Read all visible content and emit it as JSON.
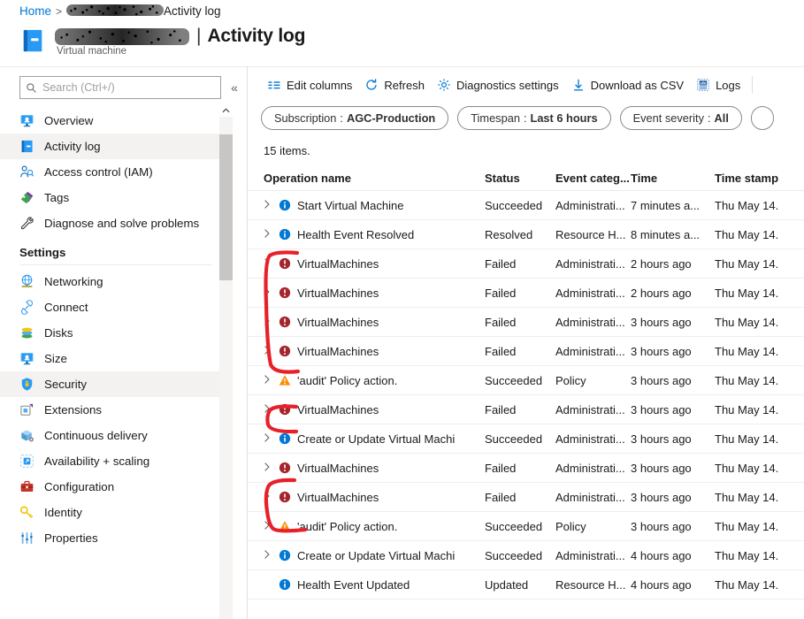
{
  "breadcrumb": {
    "home": "Home",
    "separator": ">",
    "redacted_resource": "",
    "current": "Activity log"
  },
  "header": {
    "redacted_resource_name": "",
    "divider": "|",
    "title": "Activity log",
    "subtitle": "Virtual machine",
    "icon": "virtual-machine-icon"
  },
  "sidebar": {
    "search": {
      "placeholder": "Search (Ctrl+/)",
      "value": "",
      "icon": "search-icon"
    },
    "collapse_label": "«",
    "items": [
      {
        "label": "Overview",
        "icon": "overview-icon",
        "selected": false
      },
      {
        "label": "Activity log",
        "icon": "activity-log-icon",
        "selected": true
      },
      {
        "label": "Access control (IAM)",
        "icon": "access-control-icon",
        "selected": false
      },
      {
        "label": "Tags",
        "icon": "tags-icon",
        "selected": false
      },
      {
        "label": "Diagnose and solve problems",
        "icon": "diagnose-icon",
        "selected": false
      }
    ],
    "settings_header": "Settings",
    "settings_items": [
      {
        "label": "Networking",
        "icon": "networking-icon",
        "selected": false
      },
      {
        "label": "Connect",
        "icon": "connect-icon",
        "selected": false
      },
      {
        "label": "Disks",
        "icon": "disks-icon",
        "selected": false
      },
      {
        "label": "Size",
        "icon": "size-icon",
        "selected": false
      },
      {
        "label": "Security",
        "icon": "security-icon",
        "selected": true
      },
      {
        "label": "Extensions",
        "icon": "extensions-icon",
        "selected": false
      },
      {
        "label": "Continuous delivery",
        "icon": "continuous-delivery-icon",
        "selected": false
      },
      {
        "label": "Availability + scaling",
        "icon": "availability-scaling-icon",
        "selected": false
      },
      {
        "label": "Configuration",
        "icon": "configuration-icon",
        "selected": false
      },
      {
        "label": "Identity",
        "icon": "identity-icon",
        "selected": false
      },
      {
        "label": "Properties",
        "icon": "properties-icon",
        "selected": false
      }
    ]
  },
  "toolbar": {
    "commands": [
      {
        "label": "Edit columns",
        "icon": "edit-columns-icon"
      },
      {
        "label": "Refresh",
        "icon": "refresh-icon"
      },
      {
        "label": "Diagnostics settings",
        "icon": "gear-icon"
      },
      {
        "label": "Download as CSV",
        "icon": "download-icon"
      },
      {
        "label": "Logs",
        "icon": "logs-icon"
      }
    ]
  },
  "filters": [
    {
      "name": "Subscription",
      "separator": ":",
      "value": "AGC-Production"
    },
    {
      "name": "Timespan",
      "separator": ":",
      "value": "Last 6 hours"
    },
    {
      "name": "Event severity",
      "separator": ":",
      "value": "All"
    }
  ],
  "results": {
    "count_text": "15 items.",
    "columns": [
      "Operation name",
      "Status",
      "Event categ...",
      "Time",
      "Time stamp"
    ],
    "rows": [
      {
        "op": "Start Virtual Machine",
        "severity": "info",
        "status": "Succeeded",
        "category": "Administrati...",
        "time": "7 minutes a...",
        "timestamp": "Thu May 14.",
        "expandable": true
      },
      {
        "op": "Health Event Resolved",
        "severity": "info",
        "status": "Resolved",
        "category": "Resource H...",
        "time": "8 minutes a...",
        "timestamp": "Thu May 14.",
        "expandable": true
      },
      {
        "op": "VirtualMachines",
        "severity": "error",
        "status": "Failed",
        "category": "Administrati...",
        "time": "2 hours ago",
        "timestamp": "Thu May 14.",
        "expandable": true
      },
      {
        "op": "VirtualMachines",
        "severity": "error",
        "status": "Failed",
        "category": "Administrati...",
        "time": "2 hours ago",
        "timestamp": "Thu May 14.",
        "expandable": true
      },
      {
        "op": "VirtualMachines",
        "severity": "error",
        "status": "Failed",
        "category": "Administrati...",
        "time": "3 hours ago",
        "timestamp": "Thu May 14.",
        "expandable": true
      },
      {
        "op": "VirtualMachines",
        "severity": "error",
        "status": "Failed",
        "category": "Administrati...",
        "time": "3 hours ago",
        "timestamp": "Thu May 14.",
        "expandable": true
      },
      {
        "op": "'audit' Policy action.",
        "severity": "warning",
        "status": "Succeeded",
        "category": "Policy",
        "time": "3 hours ago",
        "timestamp": "Thu May 14.",
        "expandable": true
      },
      {
        "op": "VirtualMachines",
        "severity": "error",
        "status": "Failed",
        "category": "Administrati...",
        "time": "3 hours ago",
        "timestamp": "Thu May 14.",
        "expandable": true
      },
      {
        "op": "Create or Update Virtual Machi",
        "severity": "info",
        "status": "Succeeded",
        "category": "Administrati...",
        "time": "3 hours ago",
        "timestamp": "Thu May 14.",
        "expandable": true
      },
      {
        "op": "VirtualMachines",
        "severity": "error",
        "status": "Failed",
        "category": "Administrati...",
        "time": "3 hours ago",
        "timestamp": "Thu May 14.",
        "expandable": true
      },
      {
        "op": "VirtualMachines",
        "severity": "error",
        "status": "Failed",
        "category": "Administrati...",
        "time": "3 hours ago",
        "timestamp": "Thu May 14.",
        "expandable": true
      },
      {
        "op": "'audit' Policy action.",
        "severity": "warning",
        "status": "Succeeded",
        "category": "Policy",
        "time": "3 hours ago",
        "timestamp": "Thu May 14.",
        "expandable": true
      },
      {
        "op": "Create or Update Virtual Machi",
        "severity": "info",
        "status": "Succeeded",
        "category": "Administrati...",
        "time": "4 hours ago",
        "timestamp": "Thu May 14.",
        "expandable": true
      },
      {
        "op": "Health Event Updated",
        "severity": "info",
        "status": "Updated",
        "category": "Resource H...",
        "time": "4 hours ago",
        "timestamp": "Thu May 14.",
        "expandable": false
      }
    ]
  },
  "annotations": {
    "color": "#e8202a",
    "marks": [
      {
        "name": "bracket-failed-group-1",
        "rows": "3-6"
      },
      {
        "name": "bracket-failed-group-2",
        "rows": "8"
      },
      {
        "name": "bracket-failed-group-3",
        "rows": "10-11"
      }
    ]
  },
  "colors": {
    "accent": "#0078d4",
    "error": "#a4262c",
    "warning": "#ff8c00",
    "info": "#0078d4",
    "annotation": "#e8202a"
  }
}
